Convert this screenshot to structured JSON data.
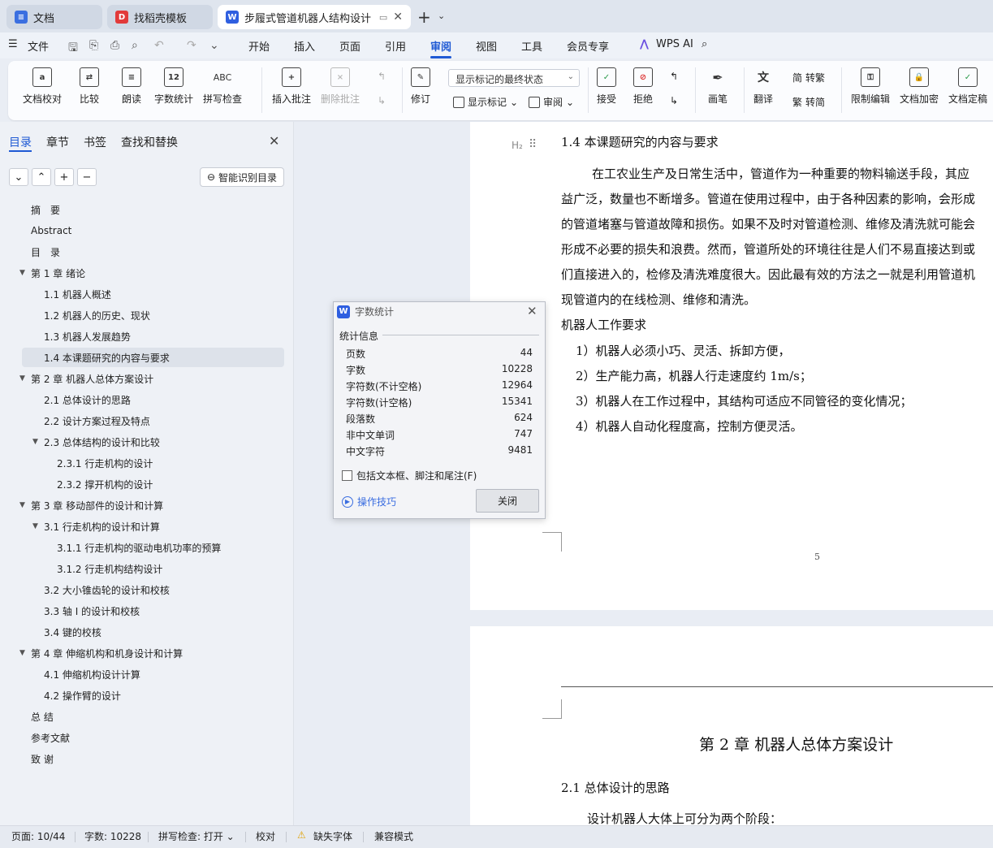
{
  "tabs": [
    {
      "label": "文档",
      "icon": "doc-icon",
      "color": "#3b6fe0"
    },
    {
      "label": "找稻壳模板",
      "icon": "docer-icon",
      "color": "#e23a3a"
    },
    {
      "label": "步履式管道机器人结构设计 说",
      "icon": "wps-writer-icon",
      "color": "#2f5fe0"
    }
  ],
  "menu": {
    "file": "文件",
    "items": [
      "开始",
      "插入",
      "页面",
      "引用",
      "审阅",
      "视图",
      "工具",
      "会员专享"
    ],
    "active": "审阅",
    "wps_ai": "WPS AI"
  },
  "ribbon": {
    "proofread": "文档校对",
    "compare": "比较",
    "read_aloud": "朗读",
    "word_count": "字数统计",
    "word_count_icon_text": "12",
    "spell_check": "拼写检查",
    "spell_check_icon_text": "ABC",
    "insert_comment": "插入批注",
    "delete_comment": "删除批注",
    "track_changes": "修订",
    "markup_select": "显示标记的最终状态",
    "show_markup": "显示标记",
    "review": "审阅",
    "accept": "接受",
    "reject": "拒绝",
    "ink": "画笔",
    "translate": "翻译",
    "to_traditional": "转繁",
    "to_simplified": "转简",
    "restrict_edit": "限制编辑",
    "encrypt": "文档加密",
    "finalize": "文档定稿"
  },
  "nav": {
    "tabs": [
      "目录",
      "章节",
      "书签",
      "查找和替换"
    ],
    "smart_toc": "智能识别目录",
    "items": [
      {
        "label": "摘　要",
        "level": 0,
        "toggle": ""
      },
      {
        "label": "Abstract",
        "level": 0,
        "toggle": ""
      },
      {
        "label": "目　录",
        "level": 0,
        "toggle": ""
      },
      {
        "label": "第 1 章  绪论",
        "level": 0,
        "toggle": "▼"
      },
      {
        "label": "1.1  机器人概述",
        "level": 1,
        "toggle": ""
      },
      {
        "label": "1.2  机器人的历史、现状",
        "level": 1,
        "toggle": ""
      },
      {
        "label": "1.3 机器人发展趋势",
        "level": 1,
        "toggle": ""
      },
      {
        "label": "1.4  本课题研究的内容与要求",
        "level": 1,
        "toggle": "",
        "selected": true
      },
      {
        "label": "第 2 章  机器人总体方案设计",
        "level": 0,
        "toggle": "▼"
      },
      {
        "label": "2.1 总体设计的思路",
        "level": 1,
        "toggle": ""
      },
      {
        "label": "2.2  设计方案过程及特点",
        "level": 1,
        "toggle": ""
      },
      {
        "label": "2.3  总体结构的设计和比较",
        "level": 1,
        "toggle": "▼"
      },
      {
        "label": "2.3.1  行走机构的设计",
        "level": 2,
        "toggle": ""
      },
      {
        "label": "2.3.2  撑开机构的设计",
        "level": 2,
        "toggle": ""
      },
      {
        "label": "第 3 章  移动部件的设计和计算",
        "level": 0,
        "toggle": "▼"
      },
      {
        "label": "3.1  行走机构的设计和计算",
        "level": 1,
        "toggle": "▼"
      },
      {
        "label": "3.1.1  行走机构的驱动电机功率的预算",
        "level": 2,
        "toggle": ""
      },
      {
        "label": "3.1.2  行走机构结构设计",
        "level": 2,
        "toggle": ""
      },
      {
        "label": "3.2 大小锥齿轮的设计和校核",
        "level": 1,
        "toggle": ""
      },
      {
        "label": "3.3  轴 I 的设计和校核",
        "level": 1,
        "toggle": ""
      },
      {
        "label": "3.4  键的校核",
        "level": 1,
        "toggle": ""
      },
      {
        "label": "第 4 章  伸缩机构和机身设计和计算",
        "level": 0,
        "toggle": "▼"
      },
      {
        "label": "4.1  伸缩机构设计计算",
        "level": 1,
        "toggle": ""
      },
      {
        "label": "4.2 操作臂的设计",
        "level": 1,
        "toggle": ""
      },
      {
        "label": "总  结",
        "level": 0,
        "toggle": ""
      },
      {
        "label": "参考文献",
        "level": 0,
        "toggle": ""
      },
      {
        "label": "致  谢",
        "level": 0,
        "toggle": ""
      }
    ]
  },
  "doc": {
    "heading_marker": "H₂",
    "section_title": "1.4  本课题研究的内容与要求",
    "paragraph_lines": [
      "在工农业生产及日常生活中，管道作为一种重要的物料输送手段，其应",
      "益广泛，数量也不断增多。管道在使用过程中，由于各种因素的影响，会形成",
      "的管道堵塞与管道故障和损伤。如果不及时对管道检测、维修及清洗就可能会",
      "形成不必要的损失和浪费。然而，管道所处的环境往往是人们不易直接达到或",
      "们直接进入的，检修及清洗难度很大。因此最有效的方法之一就是利用管道机",
      "现管道内的在线检测、维修和清洗。"
    ],
    "requirements_title": "机器人工作要求",
    "requirements": [
      "1）机器人必须小巧、灵活、拆卸方便，",
      "2）生产能力高，机器人行走速度约 1m/s；",
      "3）机器人在工作过程中，其结构可适应不同管径的变化情况；",
      "4）机器人自动化程度高，控制方便灵活。"
    ],
    "page_number": "5",
    "chapter_title": "第 2 章  机器人总体方案设计",
    "subsection_title": "2.1 总体设计的思路",
    "subsection_text": "设计机器人大体上可分为两个阶段："
  },
  "dialog": {
    "title": "字数统计",
    "group": "统计信息",
    "stats": [
      {
        "label": "页数",
        "value": "44"
      },
      {
        "label": "字数",
        "value": "10228"
      },
      {
        "label": "字符数(不计空格)",
        "value": "12964"
      },
      {
        "label": "字符数(计空格)",
        "value": "15341"
      },
      {
        "label": "段落数",
        "value": "624"
      },
      {
        "label": "非中文单词",
        "value": "747"
      },
      {
        "label": "中文字符",
        "value": "9481"
      }
    ],
    "checkbox": "包括文本框、脚注和尾注(F)",
    "tips": "操作技巧",
    "close": "关闭"
  },
  "status": {
    "page": "页面: 10/44",
    "words": "字数: 10228",
    "spell": "拼写检查: 打开",
    "proof": "校对",
    "missing_font": "缺失字体",
    "compat": "兼容模式"
  }
}
